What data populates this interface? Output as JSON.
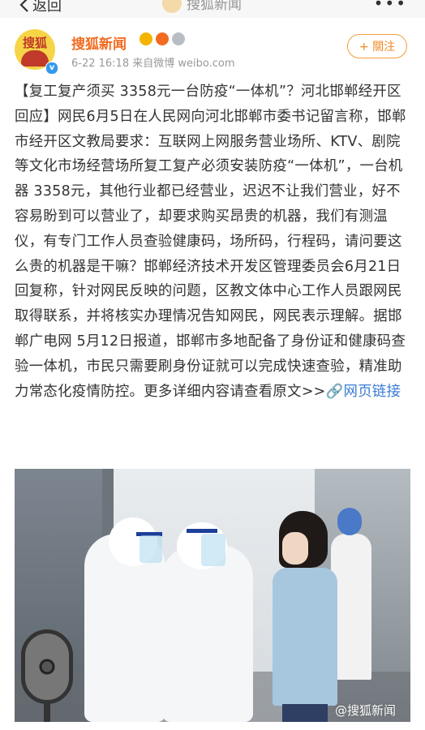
{
  "topbar": {
    "back_label": "返回",
    "title": "搜狐新闻",
    "more": "•••"
  },
  "author": {
    "avatar_text": "搜狐",
    "name": "搜狐新闻",
    "meta": "6-22 16:18  来自微博 weibo.com",
    "follow_label": "+ 關注"
  },
  "post": {
    "text": "【复工复产须买 3358元一台防疫“一体机”？河北邯郸经开区回应】网民6月5日在人民网向河北邯郸市委书记留言称，邯郸市经开区文教局要求：互联网上网服务营业场所、KTV、剧院等文化市场经营场所复工复产必须安装防疫“一体机”，一台机器 3358元，其他行业都已经营业，迟迟不让我们营业，好不容易盼到可以营业了，却要求购买昂贵的机器，我们有测温仪，有专门工作人员查验健康码，场所码，行程码，请问要这么贵的机器是干嘛？邯郸经济技术开发区管理委员会6月21日回复称，针对网民反映的问题，区教文体中心工作人员跟网民取得联系，并将核实办理情况告知网民，网民表示理解。据邯郸广电网 5月12日报道，邯郸市多地配备了身份证和健康码查验一体机，市民只需要刷身份证就可以完成快速查验，精准助力常态化疫情防控。更多详细内容请查看原文>>",
    "link_label": "🔗网页链接"
  },
  "photo": {
    "watermark": "@搜狐新闻"
  },
  "colors": {
    "brand_orange": "#f26b21",
    "link_blue": "#3b7bd6"
  }
}
